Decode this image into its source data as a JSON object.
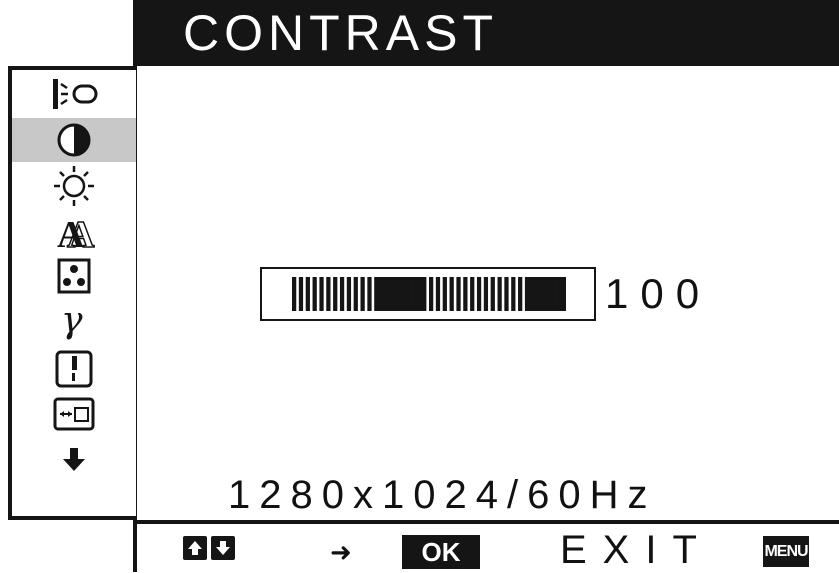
{
  "menu": {
    "title": "CONTRAST",
    "items": [
      {
        "icon": "backlight-icon",
        "selected": false
      },
      {
        "icon": "contrast-icon",
        "selected": true
      },
      {
        "icon": "brightness-icon",
        "selected": false
      },
      {
        "icon": "sharpness-icon",
        "selected": false
      },
      {
        "icon": "color-icon",
        "selected": false
      },
      {
        "icon": "gamma-icon",
        "selected": false
      },
      {
        "icon": "screen-icon",
        "selected": false
      },
      {
        "icon": "zoom-icon",
        "selected": false
      },
      {
        "icon": "scroll-down-icon",
        "selected": false
      }
    ]
  },
  "adjustment": {
    "value_label": "100",
    "level_fraction": 1.0
  },
  "status": {
    "resolution": "1280x1024/60Hz"
  },
  "footer": {
    "up_icon": "up-arrow-icon",
    "down_icon": "down-arrow-icon",
    "goto_icon": "right-arrow-icon",
    "goto_glyph": "➜",
    "ok_label": "OK",
    "exit_label": "EXIT",
    "menu_label": "MENU"
  },
  "colors": {
    "foreground": "#151515",
    "background": "#ffffff",
    "selection": "#c8c8c8"
  }
}
